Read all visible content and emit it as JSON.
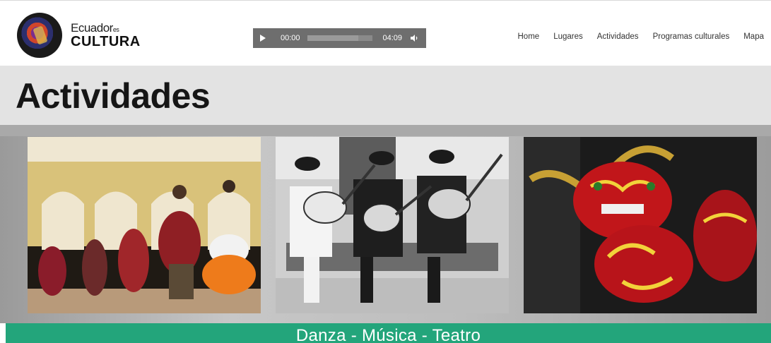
{
  "brand": {
    "name_part1": "Ecuador",
    "name_small": "es",
    "name_part2": "CULTURA"
  },
  "player": {
    "current_time": "00:00",
    "total_time": "04:09",
    "progress": 0,
    "buffered": 0.78
  },
  "nav": {
    "items": [
      "Home",
      "Lugares",
      "Actividades",
      "Programas culturales",
      "Mapa"
    ]
  },
  "page": {
    "title": "Actividades"
  },
  "banner": {
    "text": "Danza  - Música - Teatro"
  },
  "gallery": {
    "images": [
      "dance-photo",
      "music-photo",
      "theatre-mask-photo"
    ]
  },
  "colors": {
    "banner": "#23a57b",
    "player": "#6e6e6e",
    "title_band": "#e3e3e3"
  }
}
